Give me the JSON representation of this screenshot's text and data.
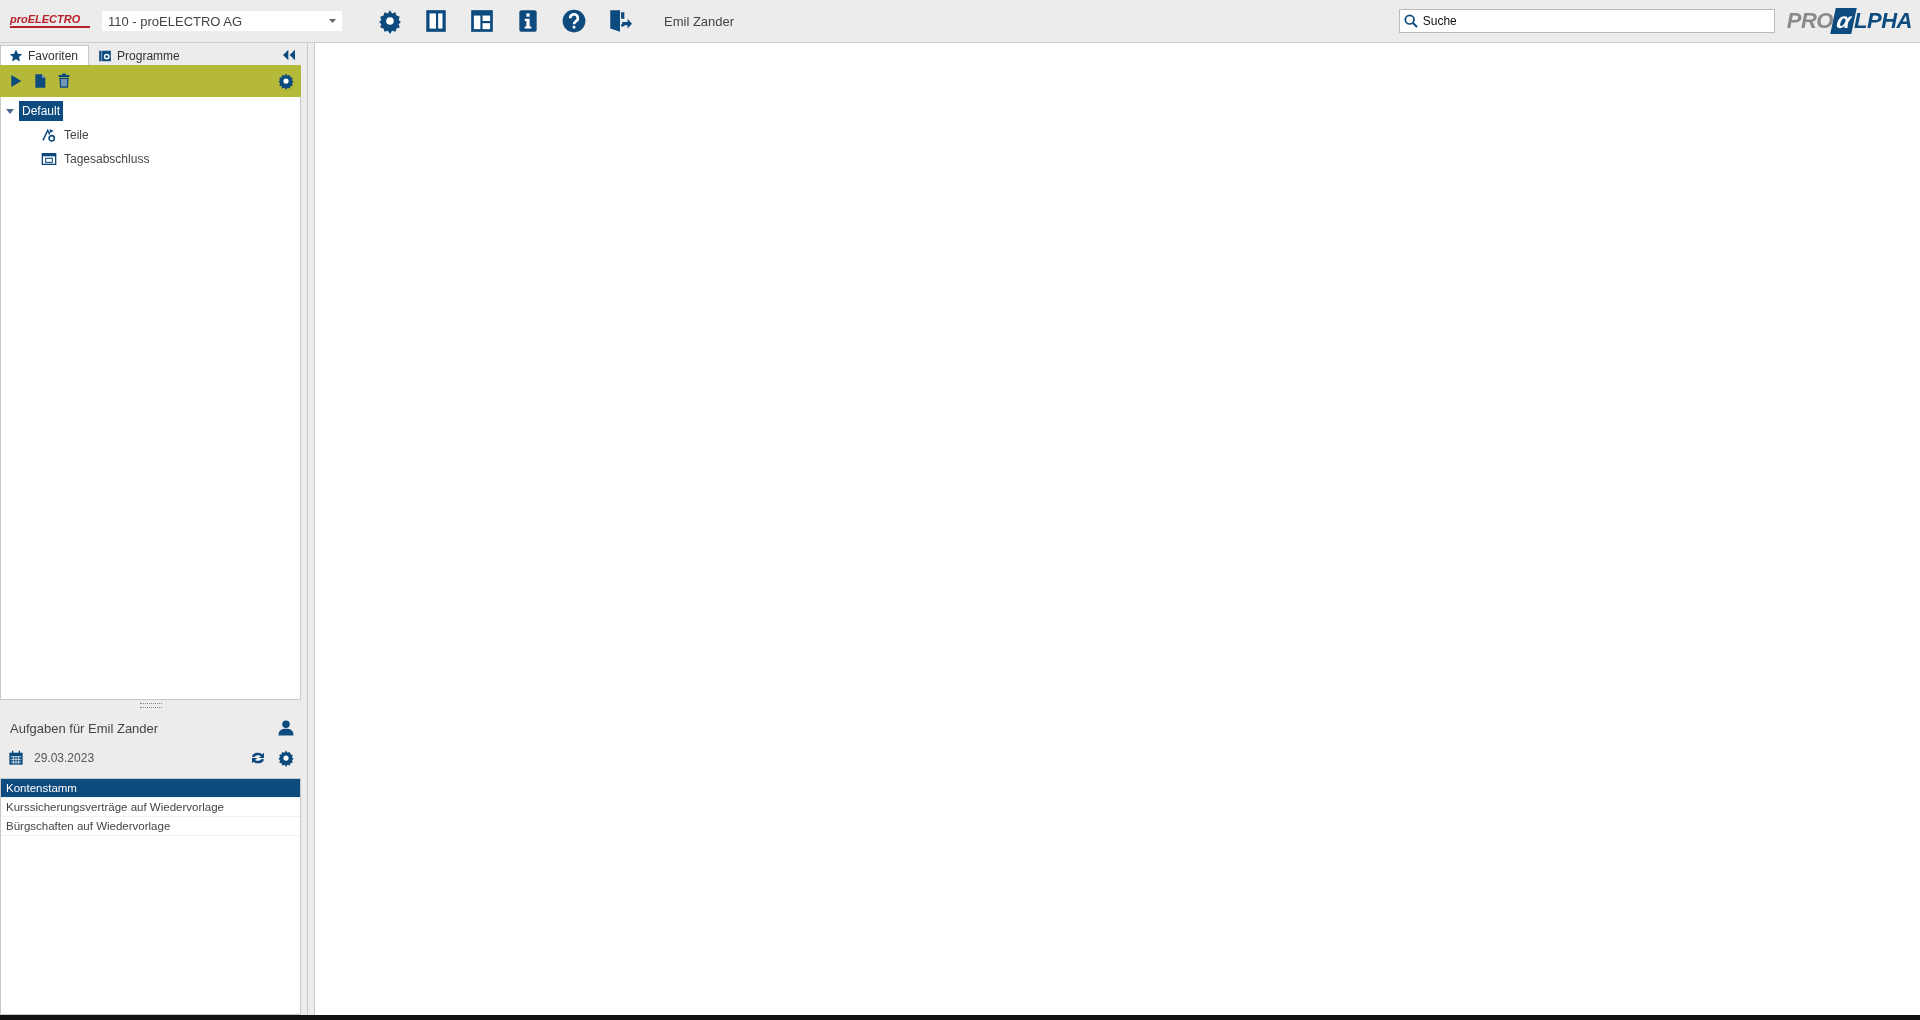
{
  "header": {
    "company_logo": "proELECTRO",
    "company_select": {
      "value": "110 - proELECTRO AG"
    },
    "toolbar_buttons": [
      {
        "kind": "settings"
      },
      {
        "kind": "panel"
      },
      {
        "kind": "layout"
      },
      {
        "kind": "info"
      },
      {
        "kind": "help"
      },
      {
        "kind": "logout"
      }
    ],
    "user_name": "Emil Zander",
    "search": {
      "placeholder": "Suche"
    },
    "brand_logo": {
      "left": "PRO",
      "mark": "α",
      "right": "LPHA"
    }
  },
  "sidebar": {
    "tabs": [
      {
        "label": "Favoriten",
        "kind": "star",
        "selected": true
      },
      {
        "label": "Programme",
        "kind": "programs",
        "selected": false
      }
    ],
    "actions": [
      {
        "kind": "run"
      },
      {
        "kind": "new"
      },
      {
        "kind": "delete"
      }
    ],
    "tree": [
      {
        "label": "Default",
        "selected": true,
        "expanded": true,
        "children": [
          {
            "label": "Teile",
            "kind": "parts",
            "selected": false
          },
          {
            "label": "Tagesabschluss",
            "kind": "window",
            "selected": false
          }
        ]
      }
    ]
  },
  "tasks": {
    "title": "Aufgaben für Emil Zander",
    "date": "29.03.2023",
    "items": [
      {
        "label": "Kontenstamm",
        "selected": true
      },
      {
        "label": "Kurssicherungsverträge auf Wiedervorlage",
        "selected": false
      },
      {
        "label": "Bürgschaften auf Wiedervorlage",
        "selected": false
      }
    ]
  }
}
